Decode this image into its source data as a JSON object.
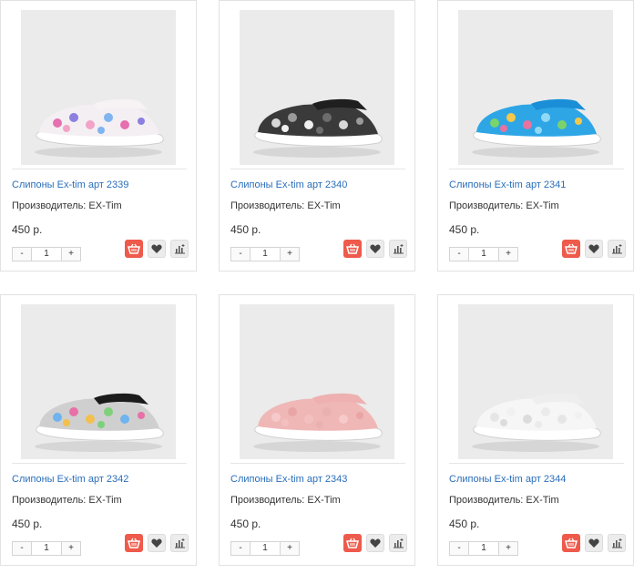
{
  "products": [
    {
      "title": "Слипоны Ex-tim арт 2339",
      "maker": "Производитель: EX-Tim",
      "price": "450 р.",
      "qty": "1",
      "minus": "-",
      "plus": "+",
      "palette": {
        "base": "#f4eff2",
        "band": "#f7f2f4",
        "spots": [
          "#e66fb0",
          "#8b7fe0",
          "#f2a3c8",
          "#7fb4f0"
        ]
      }
    },
    {
      "title": "Слипоны Ex-tim арт 2340",
      "maker": "Производитель: EX-Tim",
      "price": "450 р.",
      "qty": "1",
      "minus": "-",
      "plus": "+",
      "palette": {
        "base": "#3a3a3a",
        "band": "#1f1f1f",
        "spots": [
          "#d9d9d9",
          "#9a9a9a",
          "#f0f0f0",
          "#6c6c6c"
        ]
      }
    },
    {
      "title": "Слипоны Ex-tim арт 2341",
      "maker": "Производитель: EX-Tim",
      "price": "450 р.",
      "qty": "1",
      "minus": "-",
      "plus": "+",
      "palette": {
        "base": "#2ea6e6",
        "band": "#1a8fd8",
        "spots": [
          "#7ad36b",
          "#f4c84a",
          "#e8739e",
          "#8fd9f7"
        ]
      }
    },
    {
      "title": "Слипоны Ex-tim арт 2342",
      "maker": "Производитель: EX-Tim",
      "price": "450 р.",
      "qty": "1",
      "minus": "-",
      "plus": "+",
      "palette": {
        "base": "#cfcfcf",
        "band": "#1b1b1b",
        "spots": [
          "#6fb3ef",
          "#e86fa8",
          "#f2c04e",
          "#7ed17a"
        ]
      }
    },
    {
      "title": "Слипоны Ex-tim арт 2343",
      "maker": "Производитель: EX-Tim",
      "price": "450 р.",
      "qty": "1",
      "minus": "-",
      "plus": "+",
      "palette": {
        "base": "#f0b7b7",
        "band": "#eeb0b0",
        "spots": [
          "#f6caca",
          "#e9a5a5",
          "#f3c0c0",
          "#eab1b1"
        ]
      }
    },
    {
      "title": "Слипоны Ex-tim арт 2344",
      "maker": "Производитель: EX-Tim",
      "price": "450 р.",
      "qty": "1",
      "minus": "-",
      "plus": "+",
      "palette": {
        "base": "#f6f6f6",
        "band": "#eeeeee",
        "spots": [
          "#e6e6e6",
          "#f1f1f1",
          "#dcdcdc",
          "#ebebeb"
        ]
      }
    }
  ],
  "icons": {
    "cart": "basket-icon",
    "wishlist": "heart-icon",
    "compare": "compare-chart-icon"
  },
  "colors": {
    "link": "#2a6ebb",
    "cart_button": "#ee5a4b"
  }
}
